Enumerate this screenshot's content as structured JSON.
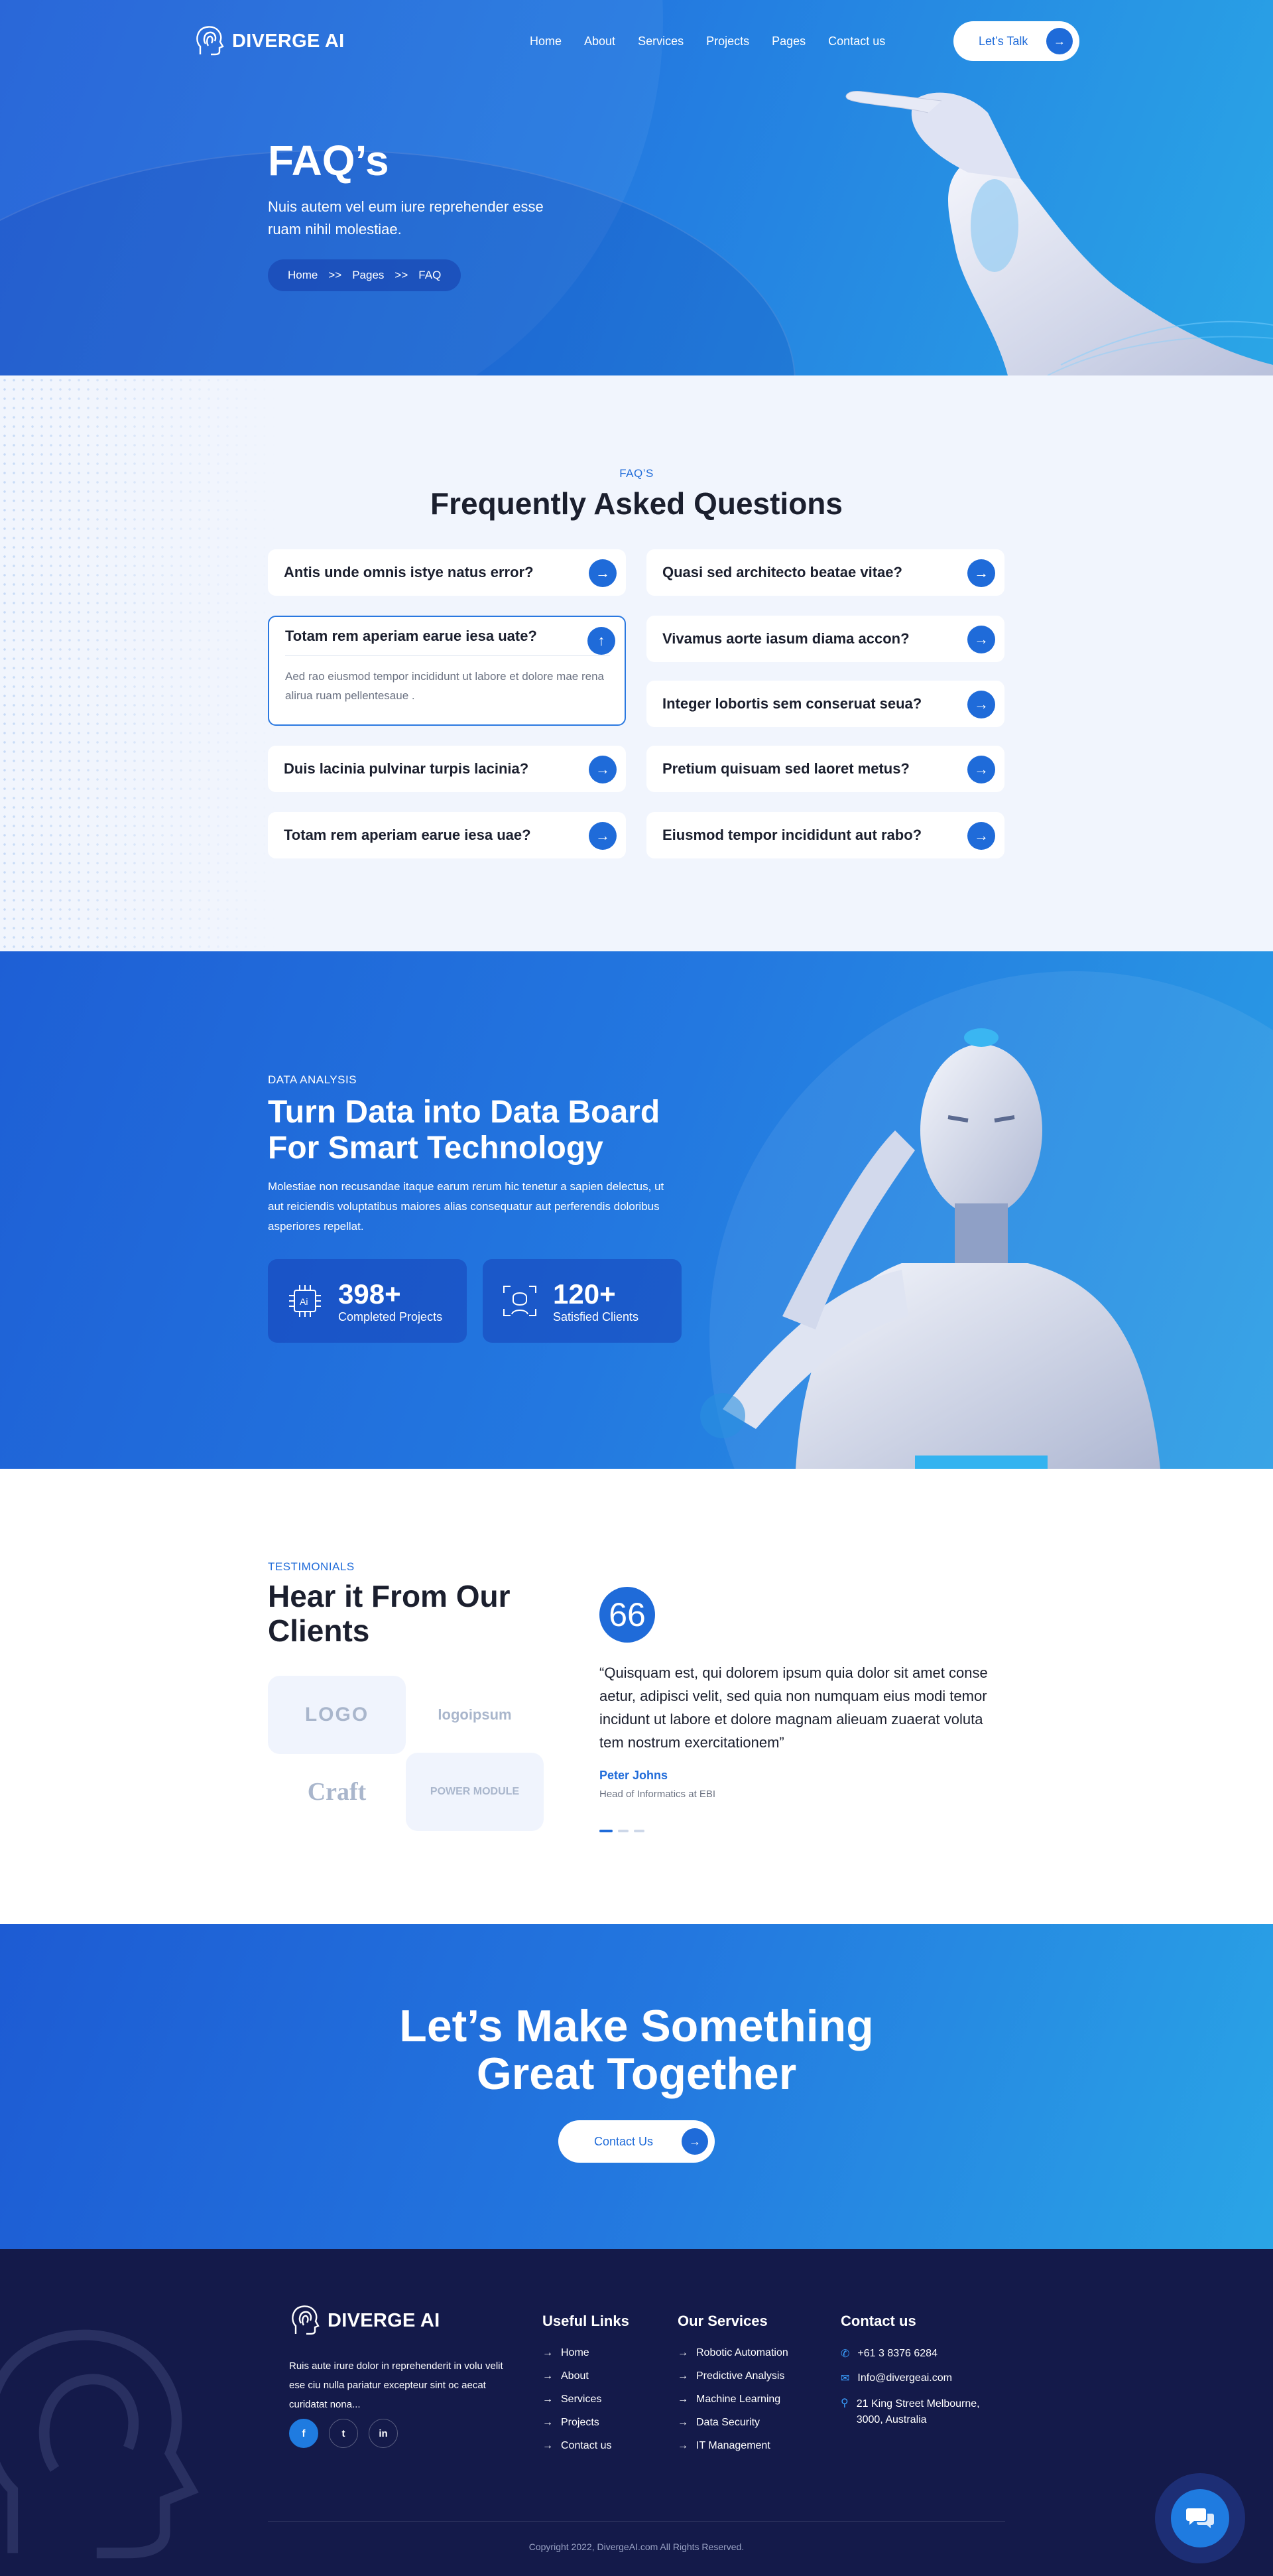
{
  "brand": {
    "name": "DIVERGE AI"
  },
  "nav": {
    "items": [
      "Home",
      "About",
      "Services",
      "Projects",
      "Pages",
      "Contact us"
    ],
    "cta": "Let’s Talk"
  },
  "hero": {
    "title": "FAQ’s",
    "subtitle": "Nuis autem vel eum iure reprehender esse ruam nihil molestiae.",
    "breadcrumb": [
      "Home",
      "Pages",
      "FAQ"
    ],
    "sep": ">>"
  },
  "faq": {
    "eyebrow": "FAQ’S",
    "title": "Frequently Asked Questions",
    "left": [
      "Antis unde omnis istye natus error?",
      "Totam rem aperiam earue iesa uate?",
      "Duis lacinia pulvinar turpis lacinia?",
      "Totam rem aperiam earue iesa uae?"
    ],
    "open_answer": "Aed rao eiusmod tempor incididunt ut labore et dolore mae rena alirua ruam pellentesaue .",
    "right": [
      "Quasi sed architecto beatae vitae?",
      "Vivamus aorte iasum diama accon?",
      "Integer lobortis sem conseruat seua?",
      "Pretium quisuam sed laoret metus?",
      "Eiusmod tempor incididunt aut rabo?"
    ]
  },
  "data": {
    "eyebrow": "DATA ANALYSIS",
    "title": "Turn Data into Data Board For Smart Technology",
    "desc": "Molestiae non recusandae itaque earum rerum hic tenetur a sapien delectus, ut aut reiciendis voluptatibus maiores alias consequatur aut perferendis doloribus asperiores repellat.",
    "stats": [
      {
        "num": "398+",
        "label": "Completed Projects"
      },
      {
        "num": "120+",
        "label": "Satisfied Clients"
      }
    ]
  },
  "testimonials": {
    "eyebrow": "TESTIMONIALS",
    "title": "Hear it From Our Clients",
    "logos": [
      "LOGO",
      "logoipsum",
      "Craft",
      "POWER MODULE"
    ],
    "quote": "“Quisquam est, qui dolorem ipsum quia dolor sit amet conse aetur, adipisci velit, sed quia non numquam eius modi temor incidunt ut labore et dolore magnam alieuam zuaerat voluta tem nostrum exercitationem”",
    "name": "Peter Johns",
    "role": "Head of Informatics at EBI",
    "quote_mark": "66"
  },
  "cta": {
    "title_line1": "Let’s Make Something",
    "title_line2": "Great Together",
    "button": "Contact Us"
  },
  "footer": {
    "about": "Ruis aute irure dolor in reprehenderit in volu velit ese ciu nulla pariatur excepteur sint oc aecat curidatat nona...",
    "social": [
      "f",
      "t",
      "in"
    ],
    "links_title": "Useful Links",
    "links": [
      "Home",
      "About",
      "Services",
      "Projects",
      "Contact us"
    ],
    "services_title": "Our Services",
    "services": [
      "Robotic Automation",
      "Predictive Analysis",
      "Machine Learning",
      "Data Security",
      "IT Management"
    ],
    "contact_title": "Contact us",
    "phone": "+61 3 8376 6284",
    "email": "Info@divergeai.com",
    "address": "21 King Street Melbourne, 3000, Australia",
    "copyright": "Copyright 2022, DivergeAI.com All Rights Reserved."
  },
  "colors": {
    "primary": "#1f6bd9",
    "footer_bg": "#141a4a",
    "hero_end": "#2aa6e6"
  }
}
